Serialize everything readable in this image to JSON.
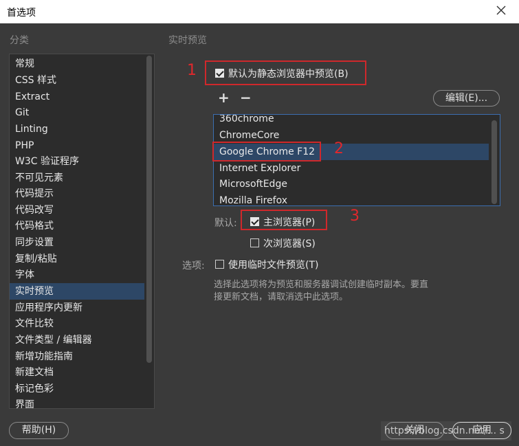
{
  "window": {
    "title": "首选项"
  },
  "category": {
    "label": "分类",
    "items": [
      "常规",
      "CSS 样式",
      "Extract",
      "Git",
      "Linting",
      "PHP",
      "W3C 验证程序",
      "不可见元素",
      "代码提示",
      "代码改写",
      "代码格式",
      "同步设置",
      "复制/粘贴",
      "字体",
      "实时预览",
      "应用程序内更新",
      "文件比较",
      "文件类型 / 编辑器",
      "新增功能指南",
      "新建文档",
      "标记色彩",
      "界面"
    ],
    "selected_index": 14
  },
  "section": {
    "label": "实时预览"
  },
  "preview": {
    "default_static_label": "默认为静态浏览器中预览(B)",
    "default_static_checked": true,
    "add_symbol": "+",
    "remove_symbol": "−",
    "edit_button": "编辑(E)...",
    "browsers": [
      "360chrome",
      "ChromeCore",
      "Google Chrome    F12",
      "Internet Explorer",
      "MicrosoftEdge",
      "Mozilla Firefox"
    ],
    "selected_browser_index": 2,
    "default_label": "默认:",
    "primary_label": "主浏览器(P)",
    "primary_checked": true,
    "secondary_label": "次浏览器(S)",
    "secondary_checked": false,
    "options_label": "选项:",
    "temp_file_label": "使用临时文件预览(T)",
    "temp_file_checked": false,
    "description": "选择此选项将为预览和服务器调试创建临时副本。要直接更新文档，请取消选中此选项。"
  },
  "annotations": [
    "1",
    "2",
    "3"
  ],
  "footer": {
    "help_button": "帮助(H)",
    "close_button": "关闭",
    "apply_button": "应用",
    "watermark": "https://blog.csdn.net/... s"
  },
  "colors": {
    "accent_red": "#d0282b",
    "selection": "#2d4766",
    "list_border": "#3c6fb1"
  }
}
